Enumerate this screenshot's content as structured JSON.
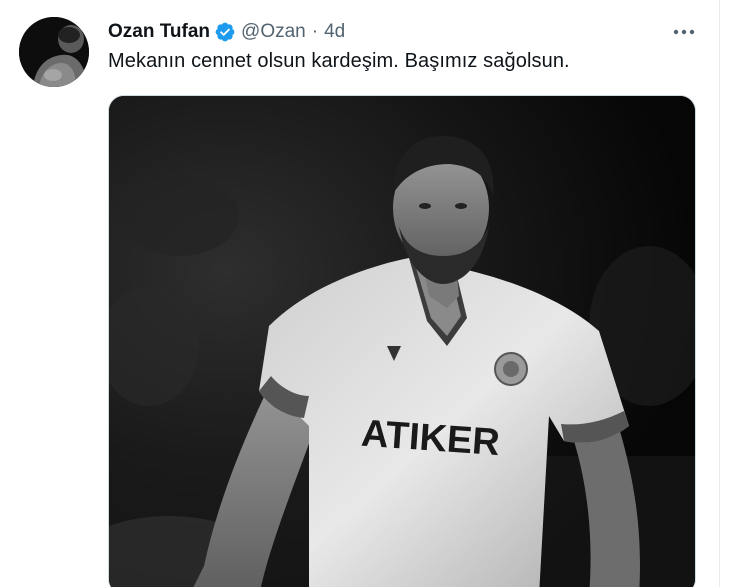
{
  "tweet": {
    "display_name": "Ozan Tufan",
    "handle": "@Ozan",
    "separator": "·",
    "timestamp": "4d",
    "text": "Mekanın cennet olsun kardeşim. Başımız sağolsun.",
    "verified_icon": "verified-badge-icon",
    "more_icon": "more-horizontal-icon",
    "verified_color": "#1d9bf0"
  },
  "media": {
    "jersey_sponsor": "ATIKER",
    "jersey_brand": "macron"
  }
}
